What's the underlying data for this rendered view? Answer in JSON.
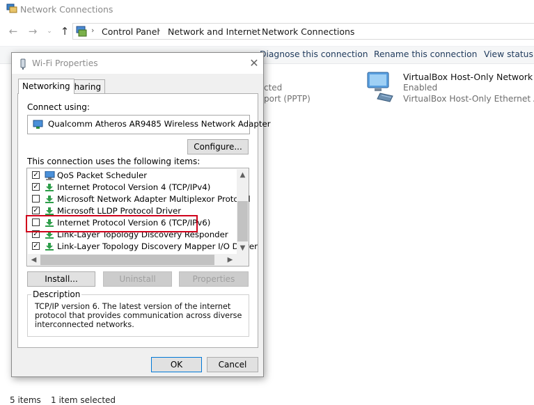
{
  "explorer": {
    "window_title": "Network Connections",
    "breadcrumb": [
      "Control Panel",
      "Network and Internet",
      "Network Connections"
    ],
    "commands": {
      "diagnose": "Diagnose this connection",
      "rename": "Rename this connection",
      "view_status": "View status of"
    },
    "partial_texts": [
      "cted",
      "port (PPTP)"
    ],
    "adapter": {
      "name": "VirtualBox Host-Only Network",
      "status": "Enabled",
      "device": "VirtualBox Host-Only Ethernet Ad..."
    },
    "status_bar": {
      "items_count": "5 items",
      "selected": "1 item selected"
    }
  },
  "dialog": {
    "title": "Wi-Fi Properties",
    "tabs": [
      "Networking",
      "Sharing"
    ],
    "connect_using_label": "Connect using:",
    "adapter_name": "Qualcomm Atheros AR9485 Wireless Network Adapter",
    "configure_label": "Configure...",
    "items_label": "This connection uses the following items:",
    "items": [
      {
        "label": "QoS Packet Scheduler",
        "checked": true,
        "icon": "qos-icon"
      },
      {
        "label": "Internet Protocol Version 4 (TCP/IPv4)",
        "checked": true,
        "icon": "protocol-icon"
      },
      {
        "label": "Microsoft Network Adapter Multiplexor Protocol",
        "checked": false,
        "icon": "protocol-icon"
      },
      {
        "label": "Microsoft LLDP Protocol Driver",
        "checked": true,
        "icon": "protocol-icon"
      },
      {
        "label": "Internet Protocol Version 6 (TCP/IPv6)",
        "checked": false,
        "icon": "protocol-icon"
      },
      {
        "label": "Link-Layer Topology Discovery Responder",
        "checked": true,
        "icon": "protocol-icon"
      },
      {
        "label": "Link-Layer Topology Discovery Mapper I/O Driver",
        "checked": true,
        "icon": "protocol-icon"
      }
    ],
    "buttons": {
      "install": "Install...",
      "uninstall": "Uninstall",
      "properties": "Properties",
      "ok": "OK",
      "cancel": "Cancel"
    },
    "description_title": "Description",
    "description_text": "TCP/IP version 6. The latest version of the internet protocol that provides communication across diverse interconnected networks.",
    "highlight_color": "#d0021b"
  }
}
